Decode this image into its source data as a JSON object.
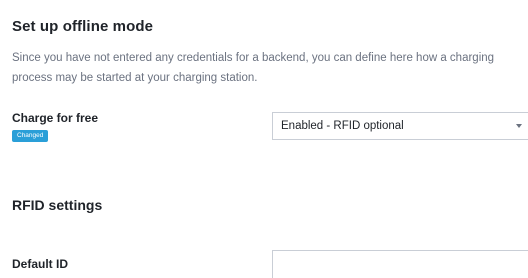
{
  "offline_mode": {
    "title": "Set up offline mode",
    "description": "Since you have not entered any credentials for a backend, you can define here how a charging process may be started at your charging station."
  },
  "charge_for_free": {
    "label": "Charge for free",
    "badge": "Changed",
    "selected_value": "Enabled - RFID optional",
    "caret_icon": "chevron-down-icon"
  },
  "rfid_settings": {
    "title": "RFID settings",
    "default_id": {
      "label": "Default ID",
      "value": ""
    }
  },
  "colors": {
    "badge_background": "#2a9fd8",
    "text_primary": "#1f2329",
    "text_secondary": "#6b7280",
    "input_border": "#c9ced6"
  }
}
